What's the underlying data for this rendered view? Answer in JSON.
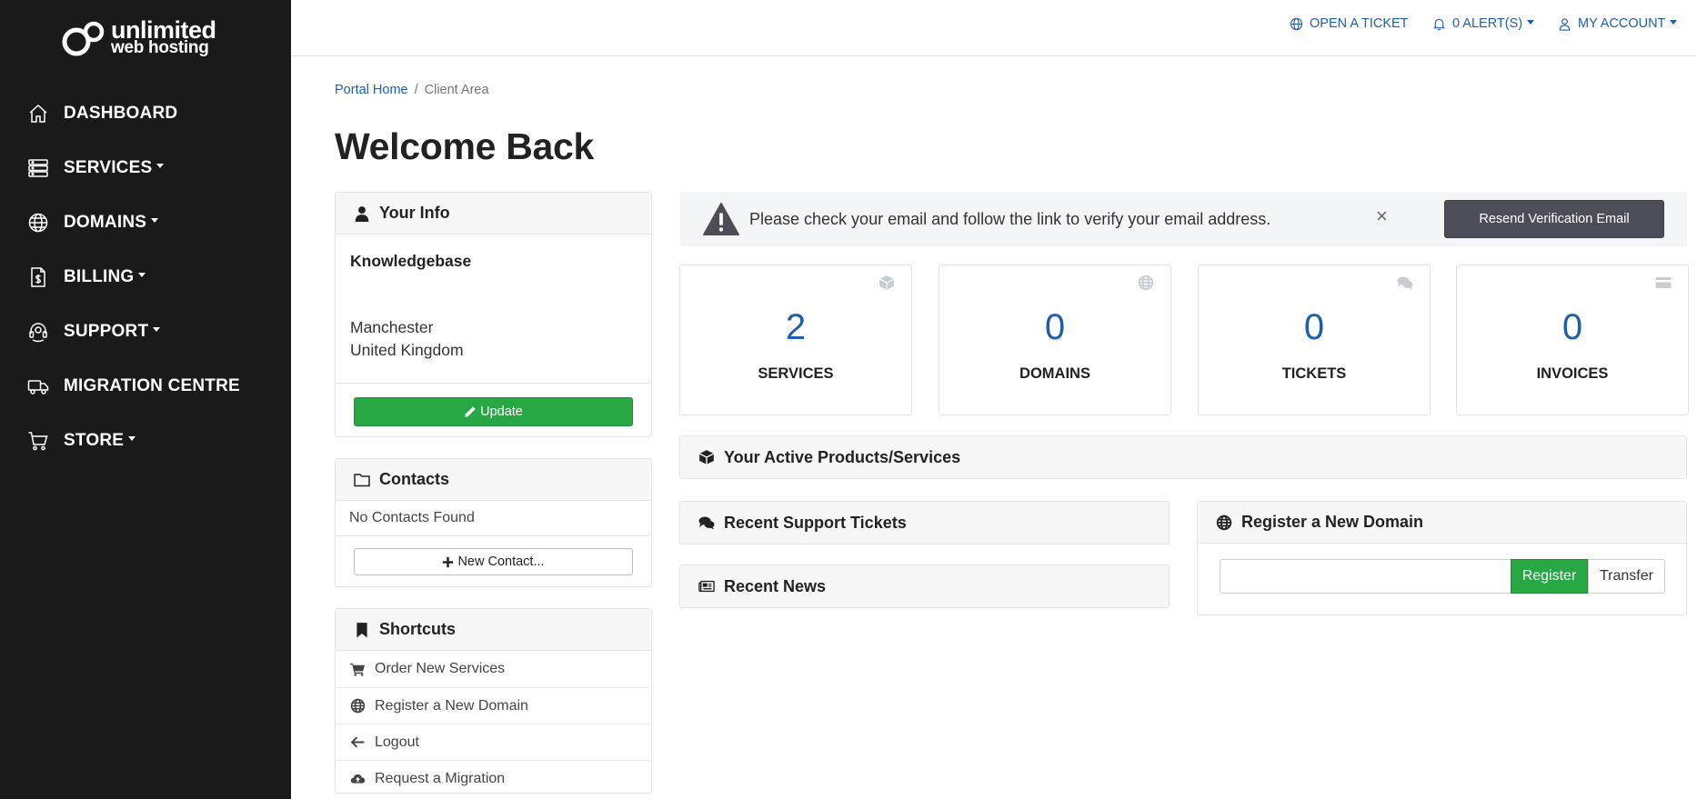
{
  "brand": {
    "line1": "unlimited",
    "line2": "web hosting"
  },
  "sidebar": {
    "items": [
      {
        "label": "DASHBOARD",
        "icon": "home-icon",
        "dropdown": false
      },
      {
        "label": "SERVICES",
        "icon": "server-icon",
        "dropdown": true
      },
      {
        "label": "DOMAINS",
        "icon": "globe-icon",
        "dropdown": true
      },
      {
        "label": "BILLING",
        "icon": "invoice-icon",
        "dropdown": true
      },
      {
        "label": "SUPPORT",
        "icon": "headset-icon",
        "dropdown": true
      },
      {
        "label": "MIGRATION CENTRE",
        "icon": "truck-icon",
        "dropdown": false
      },
      {
        "label": "STORE",
        "icon": "cart-icon",
        "dropdown": true
      }
    ]
  },
  "topbar": {
    "open_ticket": "OPEN A TICKET",
    "alerts": "0 ALERT(S)",
    "account": "MY ACCOUNT"
  },
  "breadcrumb": {
    "home": "Portal Home",
    "separator": "/",
    "current": "Client Area"
  },
  "page": {
    "title": "Welcome Back"
  },
  "your_info": {
    "title": "Your Info",
    "name": "Knowledgebase",
    "city": "Manchester",
    "country": "United Kingdom",
    "update_label": "Update"
  },
  "contacts": {
    "title": "Contacts",
    "empty": "No Contacts Found",
    "new_label": "New Contact..."
  },
  "shortcuts": {
    "title": "Shortcuts",
    "items": [
      {
        "label": "Order New Services",
        "icon": "cart-icon"
      },
      {
        "label": "Register a New Domain",
        "icon": "globe-icon"
      },
      {
        "label": "Logout",
        "icon": "arrow-left-icon"
      },
      {
        "label": "Request a Migration",
        "icon": "cloud-upload-icon"
      }
    ]
  },
  "alert": {
    "message": "Please check your email and follow the link to verify your email address.",
    "close": "×",
    "resend_label": "Resend Verification Email"
  },
  "stats": [
    {
      "value": "2",
      "label": "SERVICES",
      "icon": "cube-icon"
    },
    {
      "value": "0",
      "label": "DOMAINS",
      "icon": "globe-icon"
    },
    {
      "value": "0",
      "label": "TICKETS",
      "icon": "comments-icon"
    },
    {
      "value": "0",
      "label": "INVOICES",
      "icon": "credit-card-icon"
    }
  ],
  "panels": {
    "active_products": "Your Active Products/Services",
    "support_tickets": "Recent Support Tickets",
    "news": "Recent News",
    "register_domain": "Register a New Domain"
  },
  "domain_form": {
    "input_value": "",
    "register_label": "Register",
    "transfer_label": "Transfer"
  },
  "colors": {
    "sidebar_bg": "#1a1a1a",
    "link": "#1f5fa8",
    "green": "#28a745",
    "dark_button": "#4b4d57"
  }
}
